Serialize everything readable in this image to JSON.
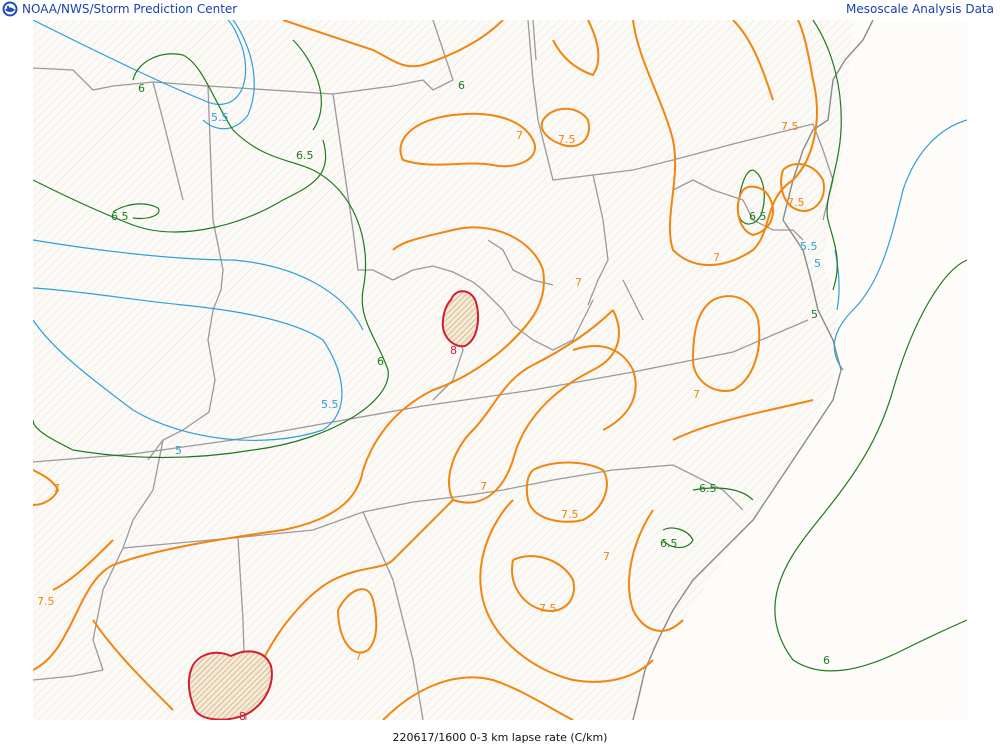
{
  "header": {
    "agency": "NOAA/NWS/Storm Prediction Center",
    "product": "Mesoscale Analysis Data",
    "logo_icon": "noaa-logo-icon"
  },
  "footer": {
    "caption": "220617/1600 0-3 km lapse rate (C/km)"
  },
  "colors": {
    "orange": "#f0860f",
    "green": "#1f7a1f",
    "blue": "#2f9fd8",
    "red": "#d21e2e",
    "borders": "#9a9a9a",
    "hatch": "#c8a070"
  },
  "contour_labels": {
    "g6_nw": "6",
    "b55_lake": "5.5",
    "g65_a": "6.5",
    "g65_b": "6.5",
    "o65_ne": "6",
    "o7_a": "7",
    "o75_a": "7.5",
    "o75_b": "7.5",
    "o65_c": "6.5",
    "o75_c": "7.5",
    "g55_d": "5.5",
    "b5_d": "5",
    "o7_b": "7",
    "o7_c": "7",
    "o7_d": "7",
    "r8_a": "8",
    "g6_c": "6",
    "b55_c": "5.5",
    "b5_c": "5",
    "o7_w": "7",
    "o7_e": "7",
    "o75_s": "7.5",
    "g65_s": "6.5",
    "g65_s2": "6.5",
    "o7_s": "7",
    "o75_sw": "7.5",
    "o75_s2": "7.5",
    "o7_s3": "7",
    "r8_b": "8",
    "g6_se": "6",
    "b5_e": "5"
  }
}
